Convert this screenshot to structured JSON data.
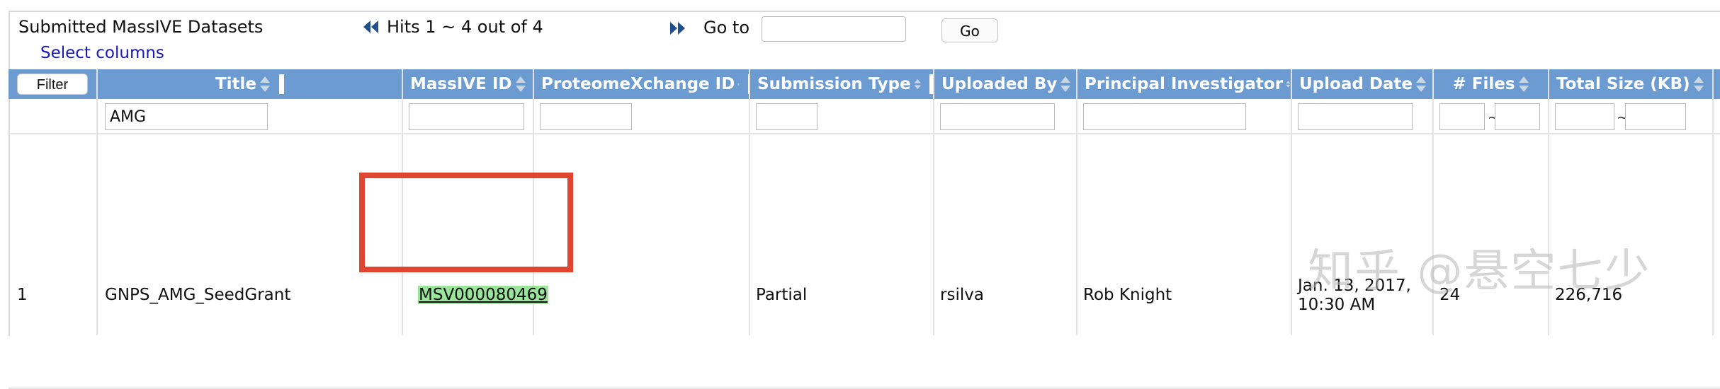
{
  "header": {
    "title": "Submitted MassIVE Datasets",
    "select_columns": "Select columns",
    "hits": "Hits 1 ~ 4 out of 4",
    "goto_label": "Go to",
    "goto_value": "",
    "go_button": "Go"
  },
  "table": {
    "filter_button": "Filter",
    "columns": [
      "Title",
      "MassIVE ID",
      "ProteomeXchange ID",
      "Submission Type",
      "Uploaded By",
      "Principal Investigator",
      "Upload Date",
      "# Files",
      "Total Size (KB)"
    ],
    "filters": {
      "title": "AMG",
      "range_separator": "~"
    },
    "rows": [
      {
        "index": "1",
        "title": "GNPS_AMG_SeedGrant",
        "massive_id": "MSV000080469",
        "proteomexchange_id": "",
        "submission_type": "Partial",
        "uploaded_by": "rsilva",
        "pi": "Rob Knight",
        "upload_date_line1": "Jan. 13, 2017,",
        "upload_date_line2": "10:30 AM",
        "files": "24",
        "total_size": "226,716"
      }
    ]
  },
  "watermark": "知乎 @悬空七少",
  "colors": {
    "header_bg": "#6b9bd1",
    "highlight": "#9be49b",
    "annotation_box": "#e04532",
    "link": "#1a1ab8"
  }
}
